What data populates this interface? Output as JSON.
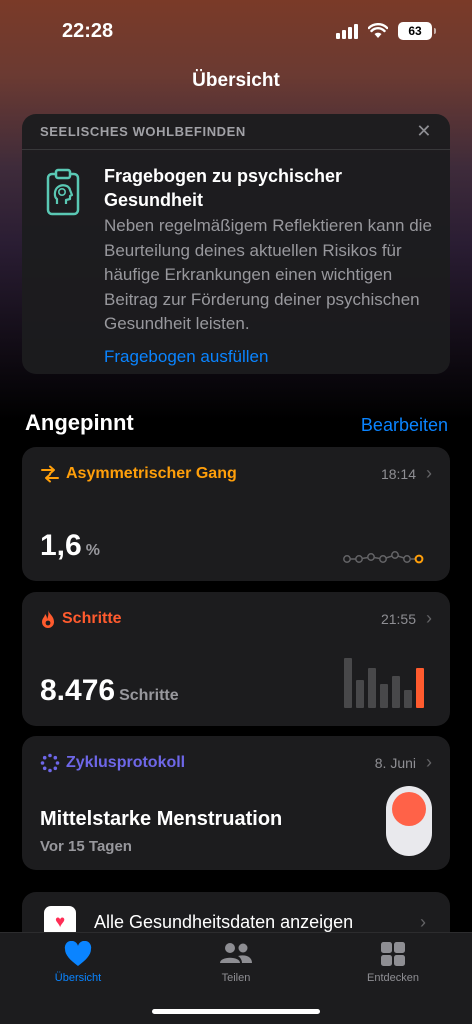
{
  "status": {
    "time": "22:28",
    "battery": "63"
  },
  "nav": {
    "title": "Übersicht"
  },
  "mental_health": {
    "header": "SEELISCHES WOHLBEFINDEN",
    "title": "Fragebogen zu psychischer Gesundheit",
    "description": "Neben regelmäßigem Reflektieren kann die Beurteilung deines aktuellen Risikos für häufige Erkrankungen einen wichtigen Beitrag zur Förderung deiner psychischen Gesundheit leisten.",
    "link": "Fragebogen ausfüllen"
  },
  "pinned": {
    "title": "Angepinnt",
    "edit": "Bearbeiten"
  },
  "metrics": {
    "gait": {
      "label": "Asymmetrischer Gang",
      "time": "18:14",
      "value": "1,6",
      "unit": "%",
      "color": "#ff9f0a"
    },
    "steps": {
      "label": "Schritte",
      "time": "21:55",
      "value": "8.476",
      "unit": "Schritte",
      "color": "#ff5b2e"
    },
    "cycle": {
      "label": "Zyklusprotokoll",
      "date": "8. Juni",
      "title": "Mittelstarke Menstruation",
      "subtitle": "Vor 15 Tagen",
      "color": "#6e67e8"
    }
  },
  "all_data": {
    "label": "Alle Gesundheitsdaten anzeigen"
  },
  "tabs": [
    {
      "label": "Übersicht",
      "icon": "heart-icon",
      "active": true
    },
    {
      "label": "Teilen",
      "icon": "people-icon",
      "active": false
    },
    {
      "label": "Entdecken",
      "icon": "grid-icon",
      "active": false
    }
  ]
}
